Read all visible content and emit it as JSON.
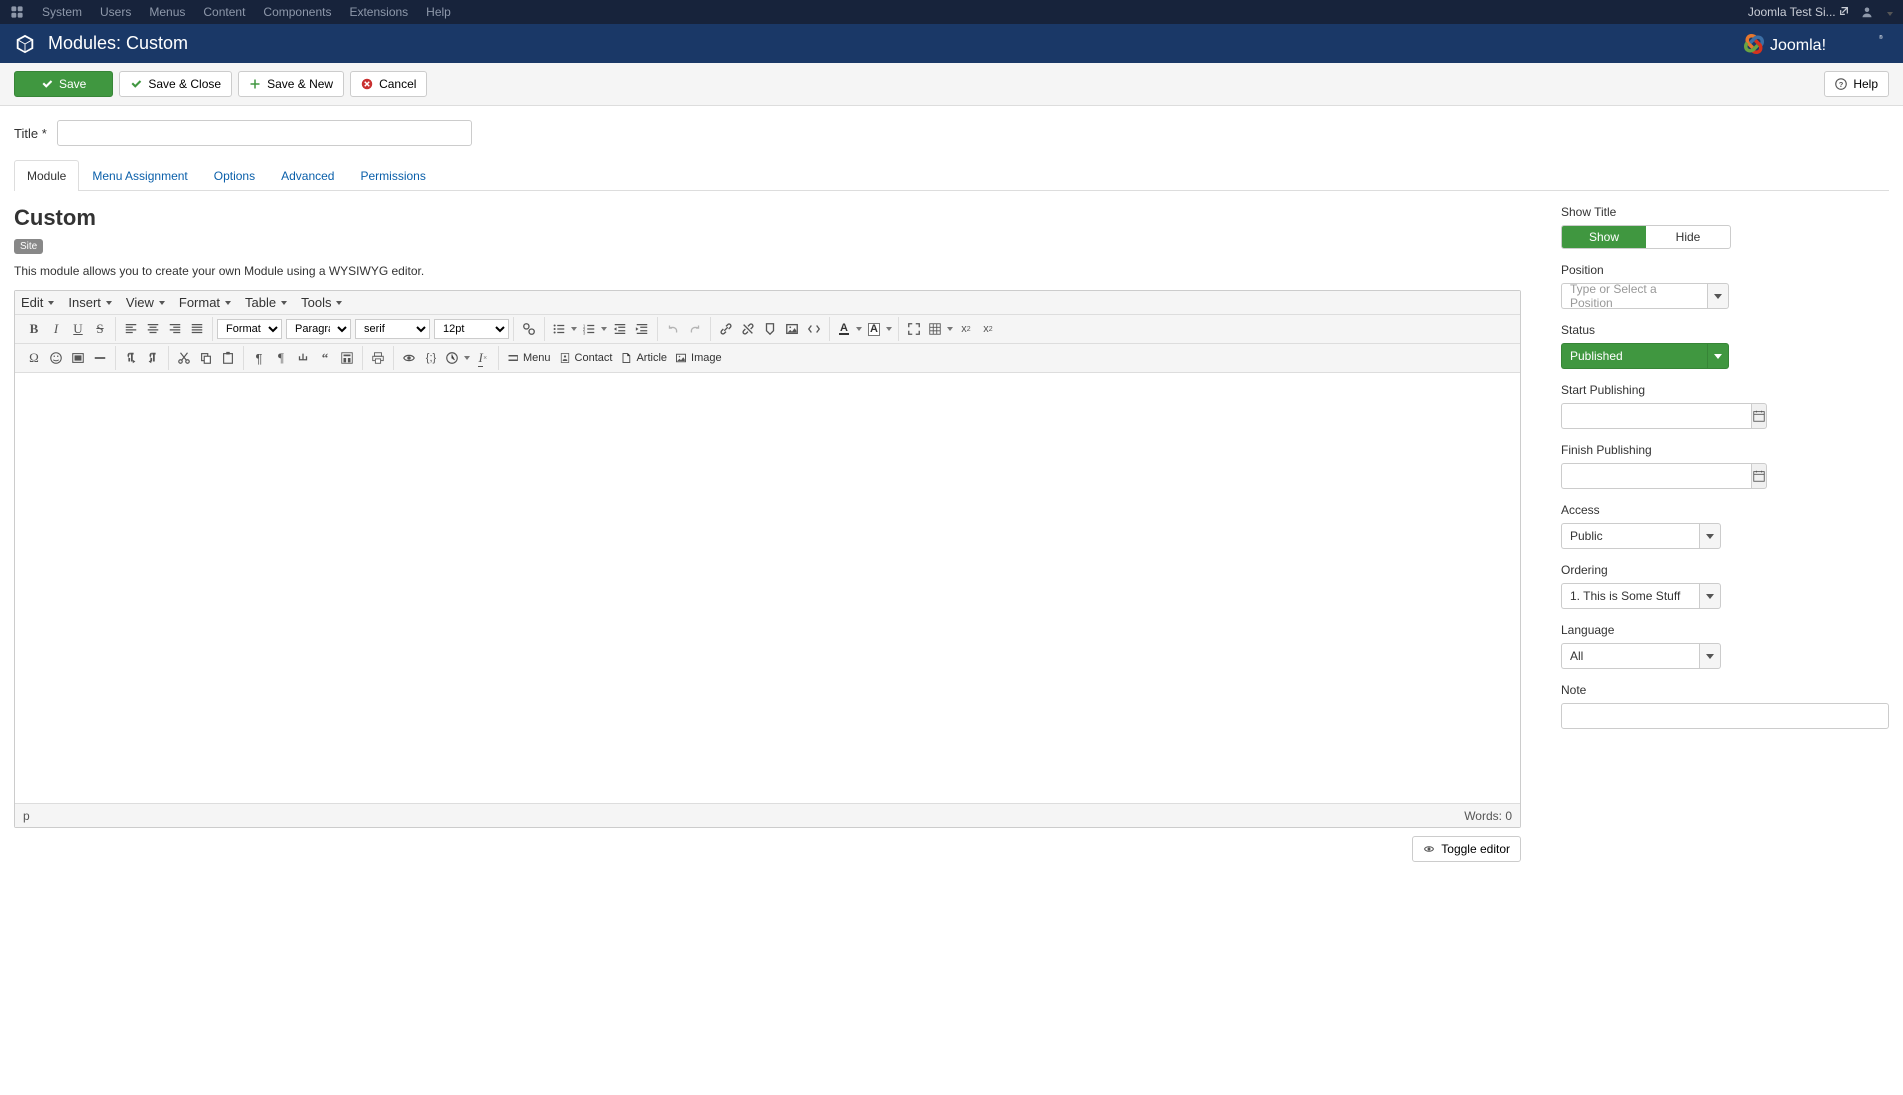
{
  "topnav": {
    "items": [
      "System",
      "Users",
      "Menus",
      "Content",
      "Components",
      "Extensions",
      "Help"
    ],
    "site_link": "Joomla Test Si..."
  },
  "header": {
    "title": "Modules: Custom",
    "brand": "Joomla!"
  },
  "toolbar": {
    "save": "Save",
    "save_close": "Save & Close",
    "save_new": "Save & New",
    "cancel": "Cancel",
    "help": "Help"
  },
  "title_field": {
    "label": "Title *"
  },
  "tabs": [
    "Module",
    "Menu Assignment",
    "Options",
    "Advanced",
    "Permissions"
  ],
  "panel": {
    "heading": "Custom",
    "badge": "Site",
    "description": "This module allows you to create your own Module using a WYSIWYG editor."
  },
  "editor": {
    "menubar": [
      "Edit",
      "Insert",
      "View",
      "Format",
      "Table",
      "Tools"
    ],
    "formats": "Formats",
    "paragraph": "Paragraph",
    "fontfamily": "serif",
    "fontsize": "12pt",
    "buttons": {
      "menu": "Menu",
      "contact": "Contact",
      "article": "Article",
      "image": "Image"
    },
    "status_path": "p",
    "words_label": "Words: ",
    "words_count": "0",
    "toggle": "Toggle editor"
  },
  "sidebar": {
    "show_title": {
      "label": "Show Title",
      "show": "Show",
      "hide": "Hide"
    },
    "position": {
      "label": "Position",
      "placeholder": "Type or Select a Position"
    },
    "status": {
      "label": "Status",
      "value": "Published"
    },
    "start_pub": {
      "label": "Start Publishing"
    },
    "finish_pub": {
      "label": "Finish Publishing"
    },
    "access": {
      "label": "Access",
      "value": "Public"
    },
    "ordering": {
      "label": "Ordering",
      "value": "1. This is Some Stuff"
    },
    "language": {
      "label": "Language",
      "value": "All"
    },
    "note": {
      "label": "Note"
    }
  }
}
